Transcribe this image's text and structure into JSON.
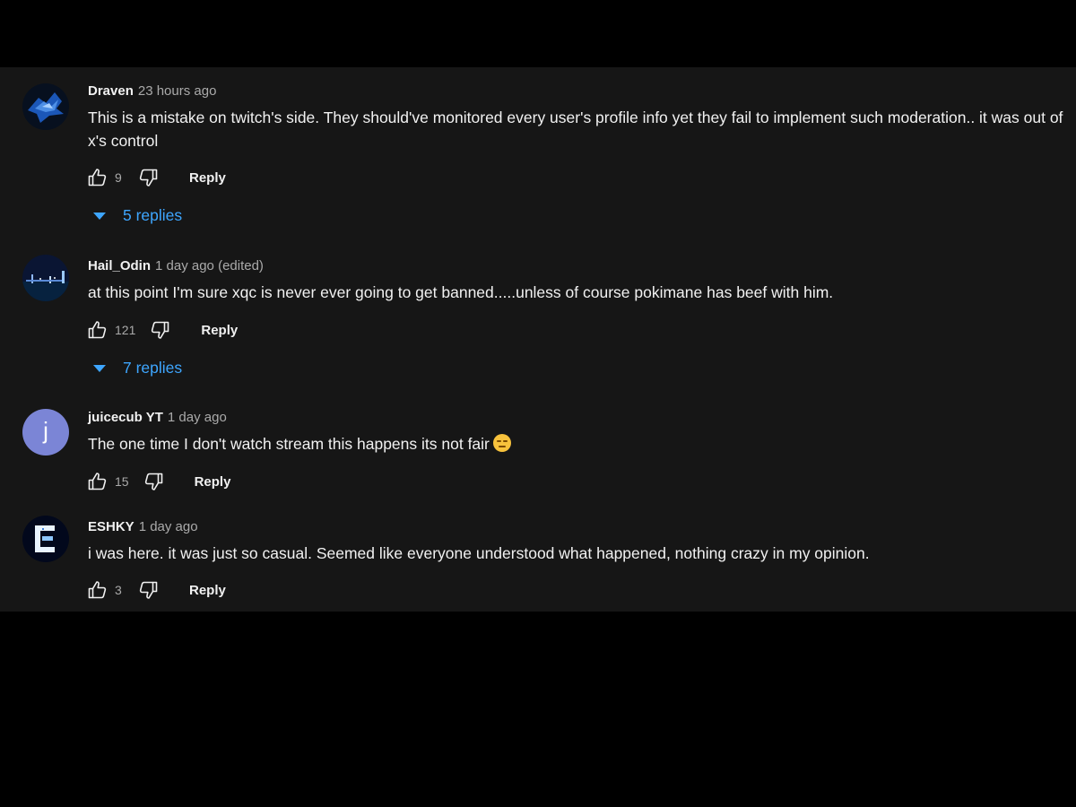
{
  "comments": [
    {
      "author": "Draven",
      "time": "23 hours ago",
      "text": "This is a mistake on twitch's side. They should've monitored every user's profile info yet they fail to implement such moderation.. it was out of x's control",
      "likes": "9",
      "reply_label": "Reply",
      "replies_label": "5 replies"
    },
    {
      "author": "Hail_Odin",
      "time": "1 day ago (edited)",
      "text": "at this point I'm sure xqc is never ever going to get banned.....unless of course pokimane has beef with him.",
      "likes": "121",
      "reply_label": "Reply",
      "replies_label": "7 replies"
    },
    {
      "author": "juicecub YT",
      "time": "1 day ago",
      "text": "The one time I don't watch stream this happens its not fair",
      "avatar_letter": "j",
      "likes": "15",
      "reply_label": "Reply"
    },
    {
      "author": "ESHKY",
      "time": "1 day ago",
      "text": "i was here. it was just so casual. Seemed like everyone understood what happened, nothing crazy in my opinion.",
      "likes": "3",
      "reply_label": "Reply"
    }
  ],
  "icons": {
    "like": "thumbs-up-icon",
    "dislike": "thumbs-down-icon",
    "expand": "caret-down-icon",
    "emoji": "pensive-face-emoji"
  },
  "colors": {
    "background": "#161616",
    "text": "#f1f1f1",
    "muted": "#aaaaaa",
    "link": "#3ea6ff",
    "avatar_j": "#7b85d6"
  }
}
